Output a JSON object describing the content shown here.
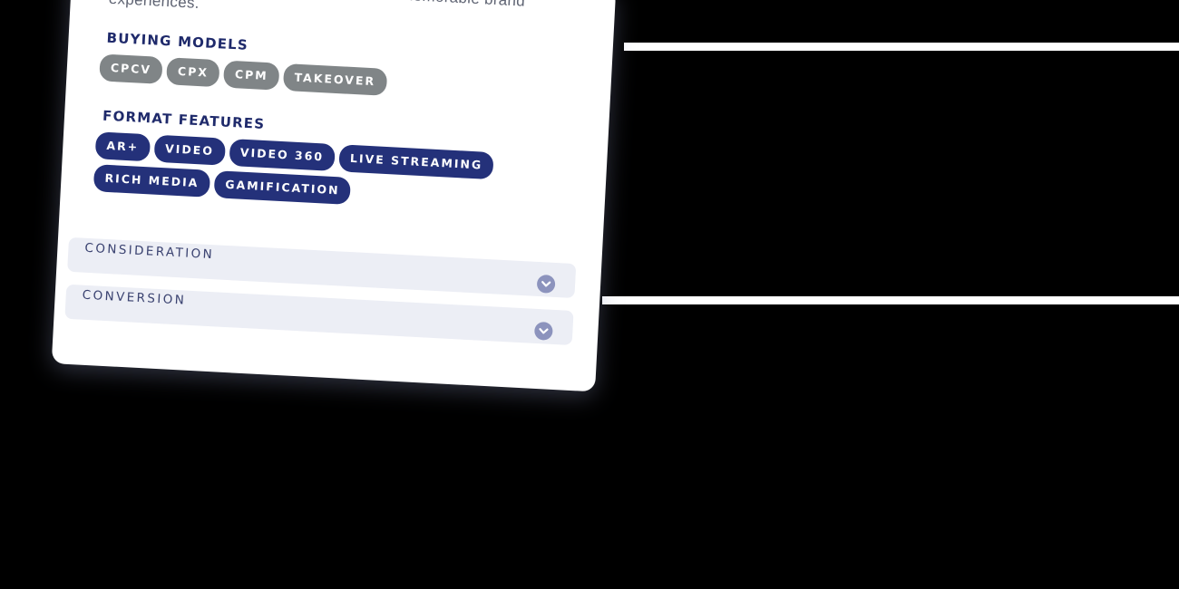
{
  "card": {
    "description": "quality views & high dwell time to deliver memorable brand experiences."
  },
  "buying_models": {
    "heading": "BUYING MODELS",
    "items": [
      "CPCV",
      "CPX",
      "CPM",
      "TAKEOVER"
    ]
  },
  "format_features": {
    "heading": "FORMAT FEATURES",
    "items": [
      "AR+",
      "VIDEO",
      "VIDEO 360",
      "LIVE STREAMING",
      "RICH MEDIA",
      "GAMIFICATION"
    ]
  },
  "accordion": {
    "items": [
      {
        "label": "CONSIDERATION",
        "icon": "chevron-down-icon"
      },
      {
        "label": "CONVERSION",
        "icon": "chevron-down-icon"
      }
    ]
  },
  "colors": {
    "heading_navy": "#1f2a6b",
    "pill_navy": "#24317a",
    "pill_gray": "#808587",
    "accordion_bg": "#eceef5",
    "chevron_bg": "#8c93bd",
    "background": "#000000"
  }
}
